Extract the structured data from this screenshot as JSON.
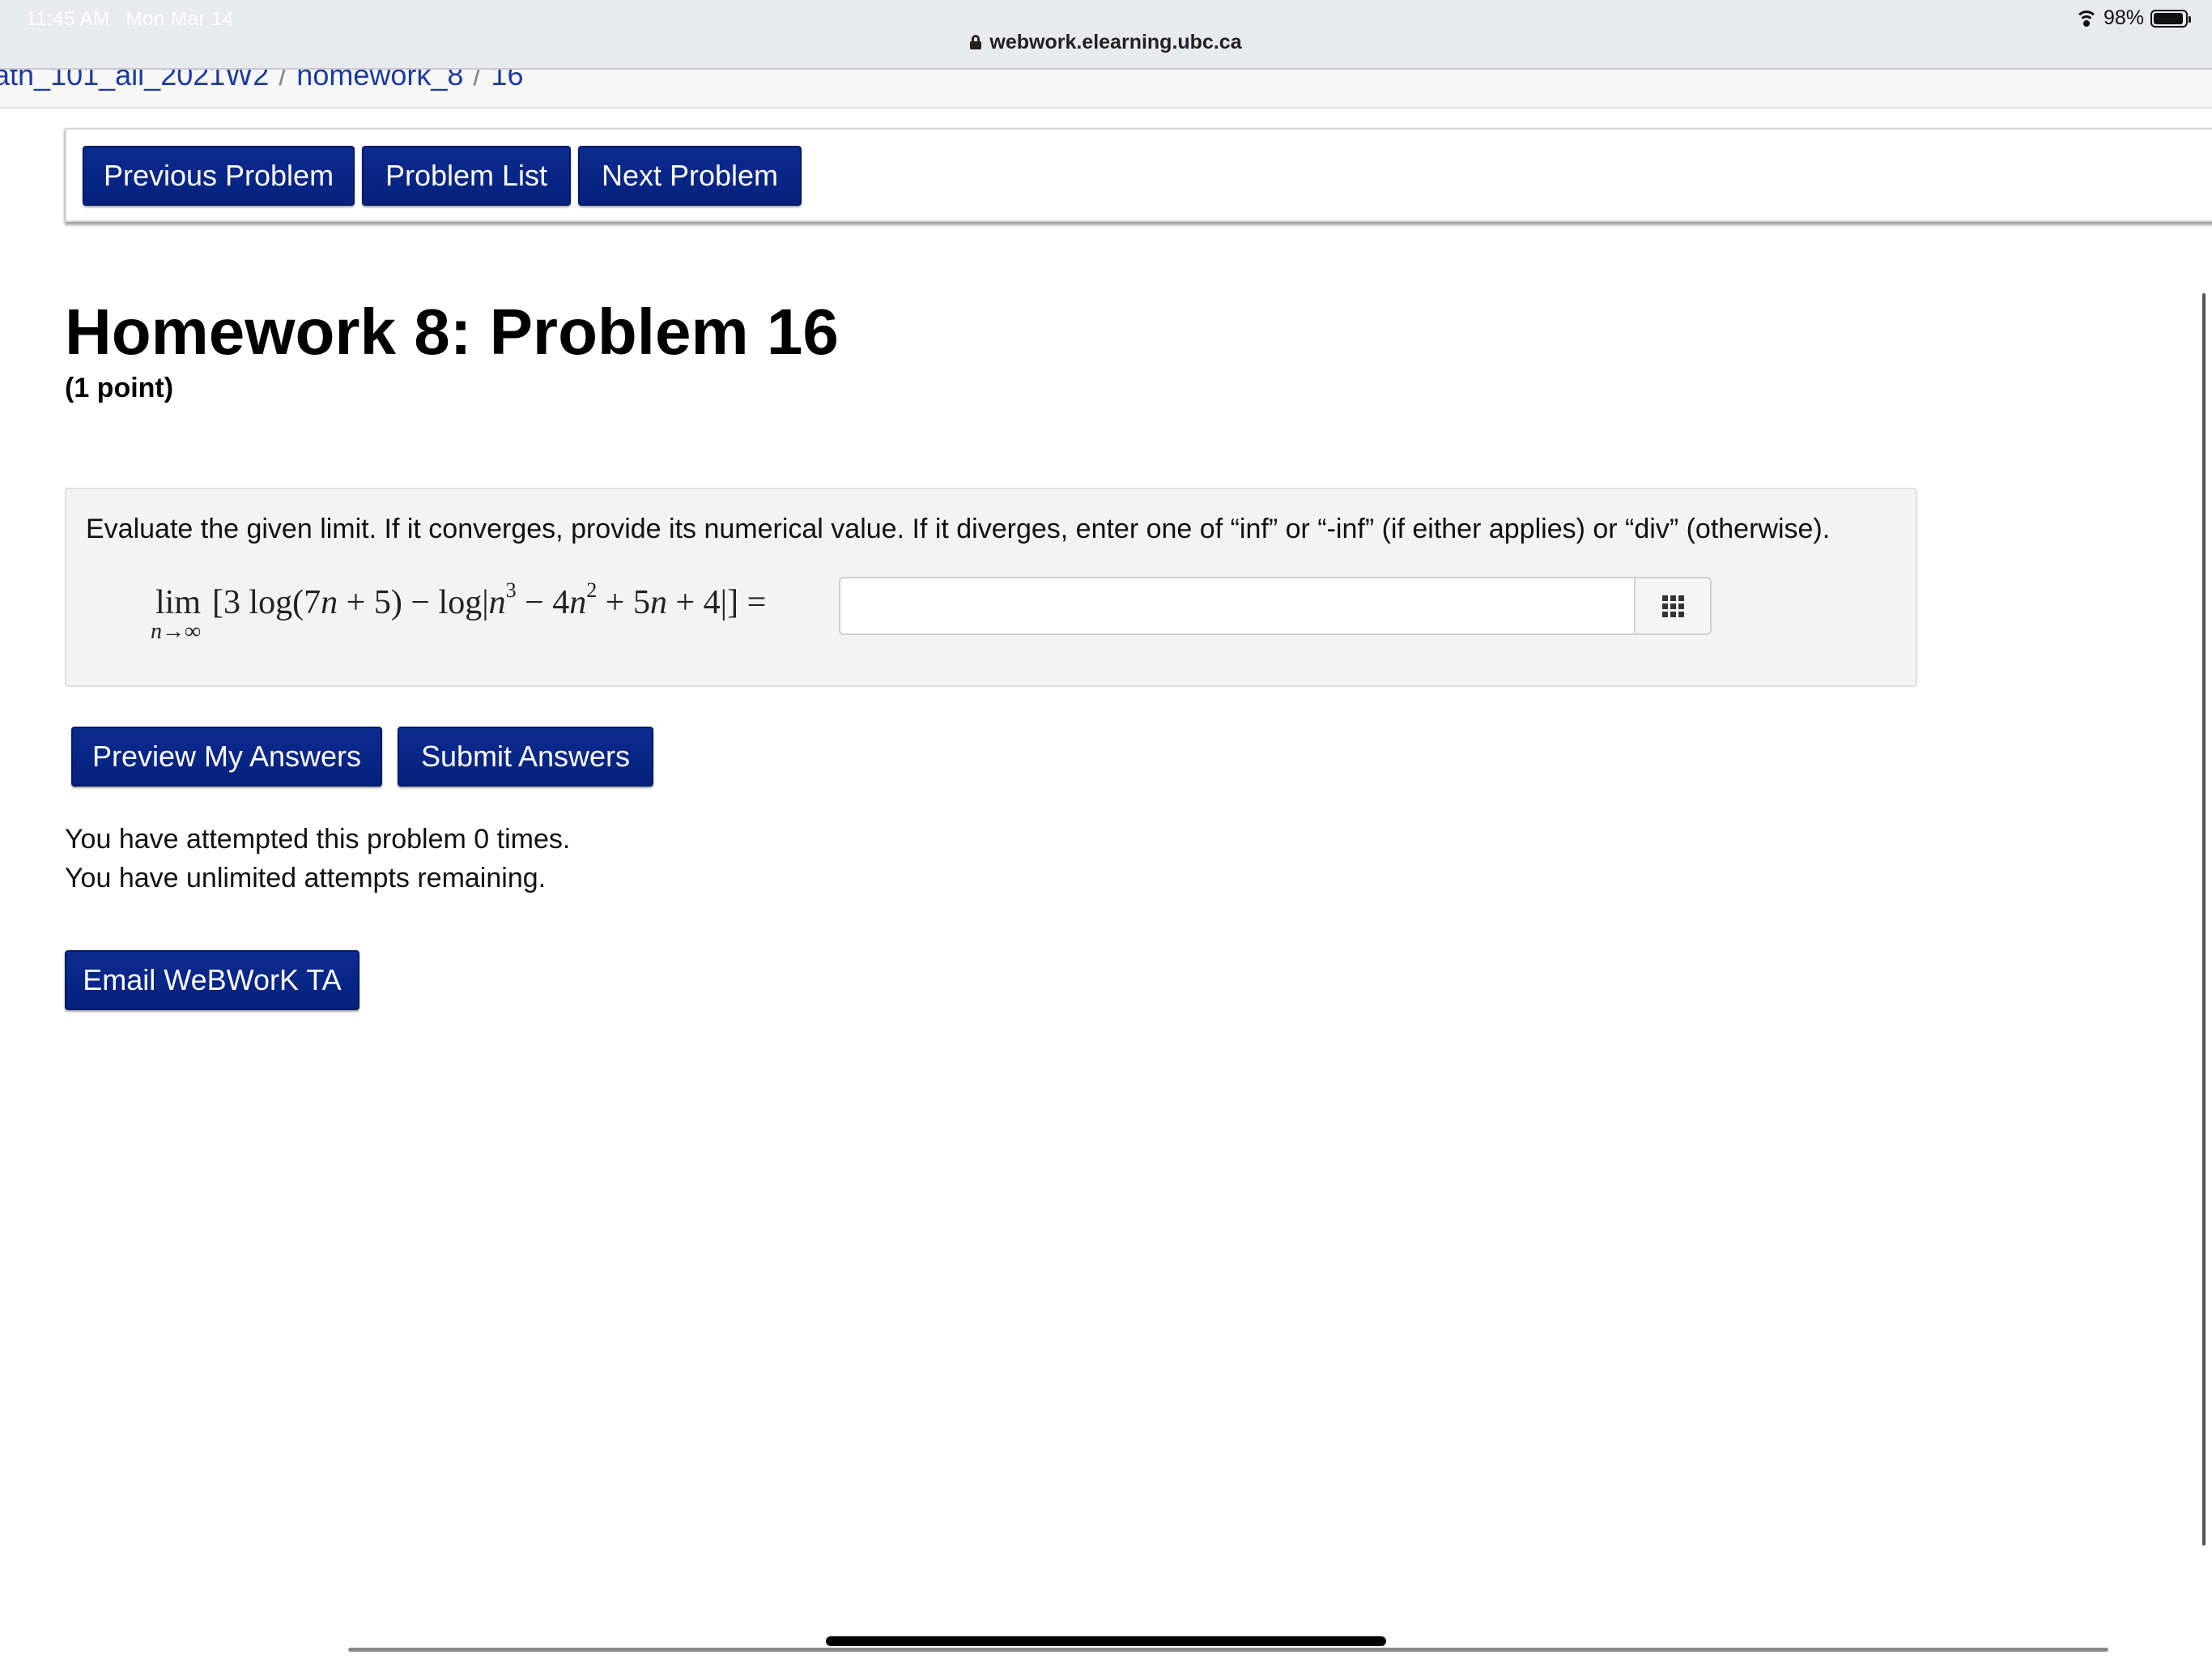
{
  "status_bar": {
    "time": "11:45 AM",
    "date": "Mon Mar 14",
    "url": "webwork.elearning.ubc.ca",
    "battery": "98%"
  },
  "breadcrumb": {
    "items": [
      "ath_101_all_2021W2",
      "homework_8",
      "16"
    ],
    "separator": "/"
  },
  "nav": {
    "previous_label": "Previous Problem",
    "list_label": "Problem List",
    "next_label": "Next Problem"
  },
  "problem": {
    "title": "Homework 8: Problem 16",
    "points": "(1 point)",
    "instructions": "Evaluate the given limit. If it converges, provide its numerical value. If it diverges, enter one of “inf” or “-inf” (if either applies) or “div” (otherwise).",
    "math": {
      "lim": "lim",
      "lim_sub": "n→∞",
      "expr_a": "[3 log(7",
      "var1": "n",
      "expr_b": " + 5) − log|",
      "var2": "n",
      "exp1": "3",
      "expr_c": " − 4",
      "var3": "n",
      "exp2": "2",
      "expr_d": " + 5",
      "var4": "n",
      "expr_e": " + 4|] ="
    },
    "answer_value": "",
    "answer_placeholder": ""
  },
  "actions": {
    "preview_label": "Preview My Answers",
    "submit_label": "Submit Answers",
    "email_label": "Email WeBWorK TA"
  },
  "attempts": {
    "line1": "You have attempted this problem 0 times.",
    "line2": "You have unlimited attempts remaining."
  },
  "colors": {
    "button_bg": "#05217d",
    "link": "#1d3aa0",
    "problem_bg": "#f3f3f3"
  }
}
